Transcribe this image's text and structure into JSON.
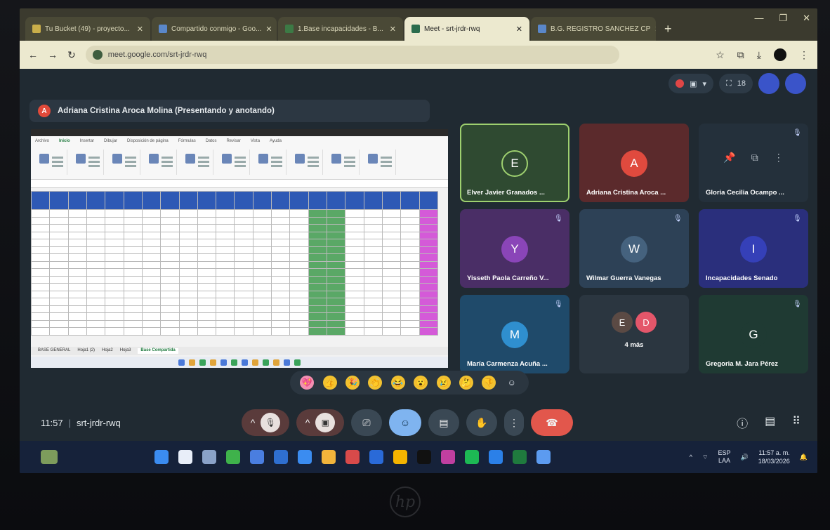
{
  "browser": {
    "tabs": [
      {
        "label": "Tu Bucket (49) - proyecto...",
        "active": false
      },
      {
        "label": "Compartido conmigo - Goo...",
        "active": false
      },
      {
        "label": "1.Base incapacidades - B...",
        "active": false
      },
      {
        "label": "Meet - srt-jrdr-rwq",
        "active": true
      },
      {
        "label": "B.G. REGISTRO SANCHEZ CP",
        "active": false
      }
    ],
    "new_tab": "+",
    "url": "meet.google.com/srt-jrdr-rwq"
  },
  "meet": {
    "presenter_initial": "A",
    "presenter_label": "Adriana Cristina Aroca Molina (Presentando y anotando)",
    "participant_count": "18",
    "participants": [
      {
        "initial": "E",
        "name": "Elver Javier Granados ...",
        "color": "#2f4a31",
        "avatar_color": "#2f4a31",
        "speaking": true,
        "muted": false
      },
      {
        "initial": "A",
        "name": "Adriana Cristina Aroca ...",
        "color": "#5b2a2c",
        "avatar_color": "#e04a3e",
        "speaking": false,
        "muted": false
      },
      {
        "initial": "",
        "name": "Gloria Cecilia Ocampo ...",
        "color": "#24303b",
        "avatar_color": "#24303b",
        "speaking": false,
        "muted": true
      },
      {
        "initial": "Y",
        "name": "Yisseth Paola Carreño V...",
        "color": "#4a2e66",
        "avatar_color": "#8a45b8",
        "speaking": false,
        "muted": true
      },
      {
        "initial": "W",
        "name": "Wilmar Guerra Vanegas",
        "color": "#2d4156",
        "avatar_color": "#45627e",
        "speaking": false,
        "muted": true
      },
      {
        "initial": "I",
        "name": "Incapacidades Senado",
        "color": "#2a2f7c",
        "avatar_color": "#3540b8",
        "speaking": false,
        "muted": true
      },
      {
        "initial": "M",
        "name": "María Carmenza Acuña ...",
        "color": "#1f4a6a",
        "avatar_color": "#2f8fcf",
        "speaking": false,
        "muted": true
      },
      {
        "initial": "",
        "name": "4 más",
        "color": "#2b3640",
        "avatar_color": "#2b3640",
        "speaking": false,
        "muted": false
      },
      {
        "initial": "G",
        "name": "Gregoria M. Jara Pérez",
        "color": "#1f3a33",
        "avatar_color": "#1f3a33",
        "speaking": false,
        "muted": true
      }
    ],
    "more_initials": [
      "E",
      "D"
    ],
    "time": "11:57",
    "meeting_code": "srt-jrdr-rwq",
    "sheet_tabs": [
      "BASE GENERAL",
      "Hoja1 (2)",
      "Hoja2",
      "Hoja3",
      "Base Compartida"
    ],
    "ribbon_tabs": [
      "Archivo",
      "Inicio",
      "Insertar",
      "Dibujar",
      "Disposición de página",
      "Fórmulas",
      "Datos",
      "Revisar",
      "Vista",
      "Ayuda"
    ]
  },
  "reactions": [
    "💖",
    "👍",
    "🎉",
    "👏",
    "😂",
    "😮",
    "😢",
    "🤔",
    "👎",
    "☺"
  ],
  "taskbar": {
    "lang_top": "ESP",
    "lang_bottom": "LAA",
    "clock_time": "11:57 a. m.",
    "clock_date": "18/03/2026"
  }
}
